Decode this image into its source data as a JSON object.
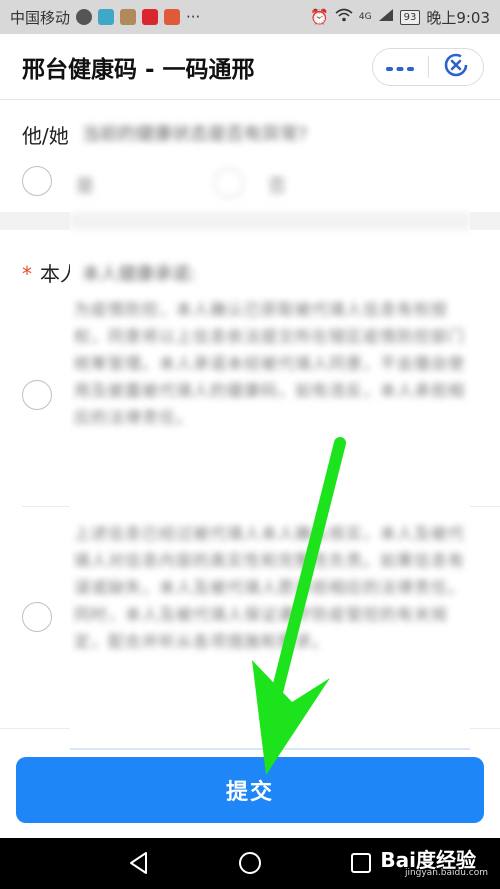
{
  "status_bar": {
    "carrier": "中国移动",
    "network": "4G",
    "battery": "93",
    "time": "晚上9:03"
  },
  "header": {
    "title": "邢台健康码 - 一码通邢",
    "more_icon": "more-dots-icon",
    "close_icon": "miniprogram-close-icon"
  },
  "form": {
    "q1_label": "他/她",
    "q2_label": "本人",
    "q2_required_mark": "*"
  },
  "overlay": {
    "question": "当前的健康状态是否有异常?",
    "option_yes": "是",
    "option_no": "否",
    "declaration_title": "本人健康承诺:",
    "paragraph1": "为疫情防控，本人确认已获取被代填人信息有权授权，同意将以上信息依法提交所在辖区疫情防控部门统筹管理。本人承诺本经被代填人同意，不会擅自使用及披露被代填人的健康码，如有违反，本人承担相应的法律责任。",
    "paragraph2": "上述信息已经过被代填人本人确认核实，本人及被代填人对信息内容的真实性和完整性负责。如果信息有误或缺失，本人及被代填人愿承担相应的法律责任。同时，本人及被代填人保证遵守防疫管控的有关规定，配合并听从各项措施和要求。"
  },
  "submit": {
    "label": "提交"
  },
  "navbar": {
    "back_icon": "back-triangle-icon",
    "home_icon": "home-circle-icon",
    "recents_icon": "recents-square-icon",
    "watermark": "Bai度经验",
    "watermark_url": "jingyan.baidu.com"
  },
  "colors": {
    "primary": "#1f86f7",
    "required": "#e8502d",
    "arrow": "#1de31d"
  }
}
